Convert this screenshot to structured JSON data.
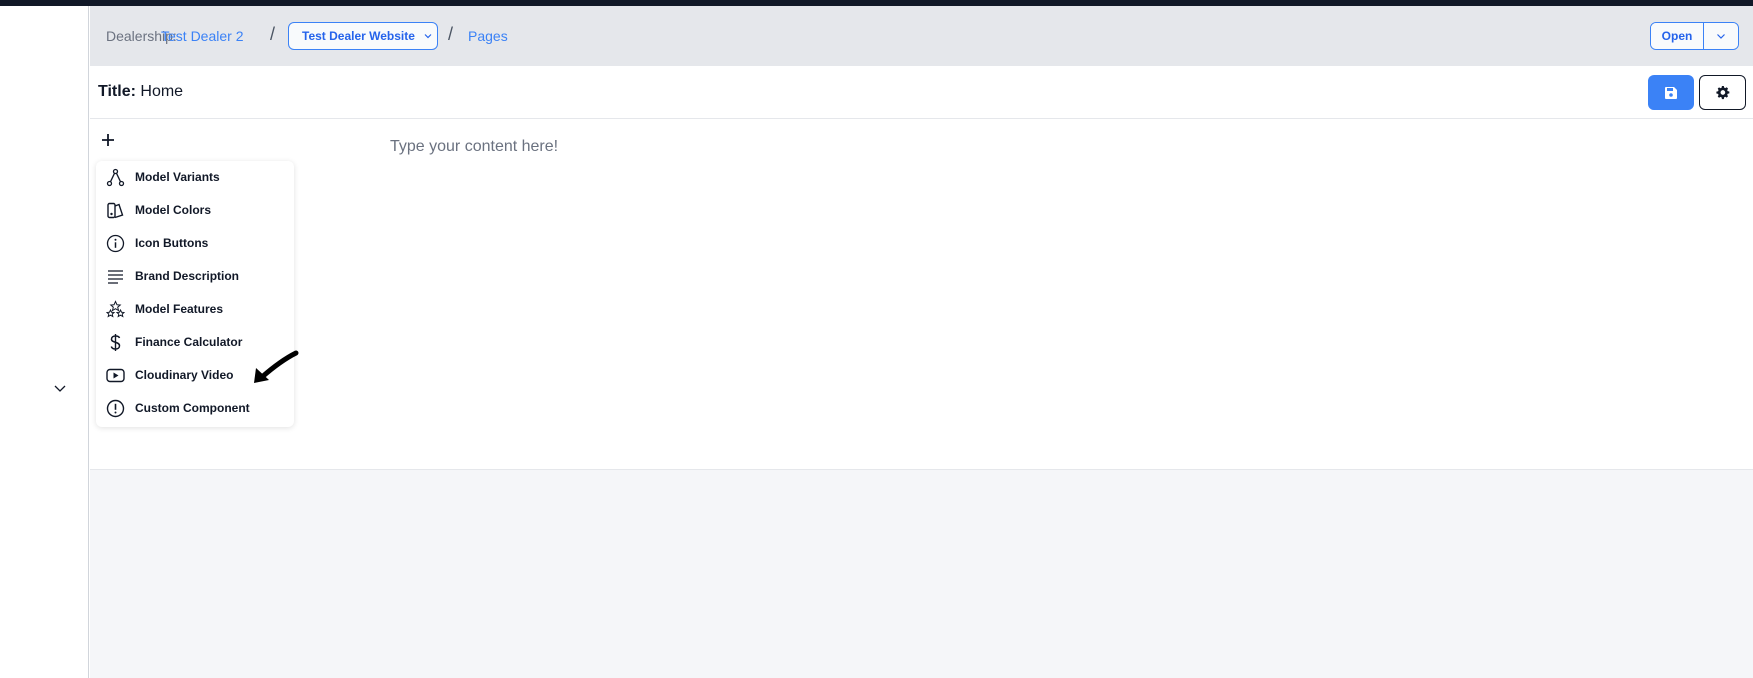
{
  "breadcrumb": {
    "label": "Dealership:",
    "dealer": "Test Dealer 2",
    "website": "Test Dealer Website",
    "pages": "Pages"
  },
  "actions": {
    "open_label": "Open"
  },
  "editor": {
    "title_label": "Title:",
    "title_value": "Home",
    "placeholder": "Type your content here!"
  },
  "menu": {
    "items": [
      {
        "label": "Model Variants",
        "icon": "branch-icon"
      },
      {
        "label": "Model Colors",
        "icon": "palette-icon"
      },
      {
        "label": "Icon Buttons",
        "icon": "info-circle-icon"
      },
      {
        "label": "Brand Description",
        "icon": "text-lines-icon"
      },
      {
        "label": "Model Features",
        "icon": "stars-icon"
      },
      {
        "label": "Finance Calculator",
        "icon": "dollar-icon"
      },
      {
        "label": "Cloudinary Video",
        "icon": "video-play-icon"
      },
      {
        "label": "Custom Component",
        "icon": "exclamation-circle-icon"
      }
    ]
  },
  "colors": {
    "accent": "#3b82f6",
    "link": "#3b82f6"
  }
}
